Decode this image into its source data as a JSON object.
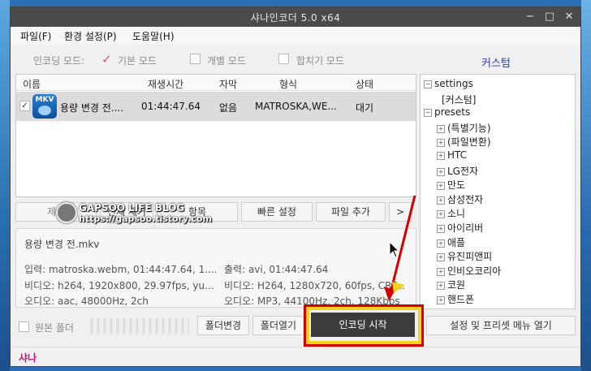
{
  "window": {
    "title": "샤나인코더  5.0 x64",
    "controls": {
      "minimize": "−",
      "maximize": "□",
      "close": "✕"
    }
  },
  "menu": [
    "파일(F)",
    "환경 설정(P)",
    "도움말(H)"
  ],
  "modes": {
    "label": "인코딩 모드:",
    "basic": "기본 모드",
    "individual": "개별 모드",
    "merge": "합치기 모드",
    "custom": "커스텀"
  },
  "list": {
    "headers": [
      "이름",
      "재생시간",
      "자막",
      "형식",
      "상태"
    ],
    "rows": [
      {
        "icon_badge": "MKV",
        "name": "용량 변경 전....",
        "duration": "01:44:47.64",
        "subtitle": "없음",
        "format": "MATROSKA,WE...",
        "status": "대기"
      }
    ]
  },
  "list_buttons": {
    "remove": "제거",
    "remove_all": "전체 제거",
    "item": "항목",
    "quick_settings": "빠른 설정",
    "add_file": "파일 추가",
    "more": ">"
  },
  "info": {
    "filename": "용량 변경 전.mkv",
    "input": "입력: matroska.webm, 01:44:47.64, 1....",
    "output": "출력: avi, 01:44:47.64",
    "video_in": "비디오: h264, 1920x800, 29.97fps,  yu...",
    "video_out": "비디오: H264, 1280x720, 60fps, CRF...",
    "audio_in": "오디오: aac, 48000Hz, 2ch",
    "audio_out": "오디오: MP3, 44100Hz, 2ch, 128Kbps"
  },
  "tree": [
    {
      "label": "settings",
      "level": 0,
      "expander": "−"
    },
    {
      "label": "[커스텀]",
      "level": 1,
      "expander": ""
    },
    {
      "label": "presets",
      "level": 0,
      "expander": "−"
    },
    {
      "label": "(특별기능)",
      "level": 1,
      "expander": "+"
    },
    {
      "label": "(파일변환)",
      "level": 1,
      "expander": "+"
    },
    {
      "label": "HTC",
      "level": 1,
      "expander": "+"
    },
    {
      "label": "LG전자",
      "level": 1,
      "expander": "+"
    },
    {
      "label": "만도",
      "level": 1,
      "expander": "+"
    },
    {
      "label": "삼성전자",
      "level": 1,
      "expander": "+"
    },
    {
      "label": "소니",
      "level": 1,
      "expander": "+"
    },
    {
      "label": "아이리버",
      "level": 1,
      "expander": "+"
    },
    {
      "label": "애플",
      "level": 1,
      "expander": "+"
    },
    {
      "label": "유진피앤피",
      "level": 1,
      "expander": "+"
    },
    {
      "label": "인비오코리아",
      "level": 1,
      "expander": "+"
    },
    {
      "label": "코원",
      "level": 1,
      "expander": "+"
    },
    {
      "label": "핸드폰",
      "level": 1,
      "expander": "+"
    }
  ],
  "bottom": {
    "source_folder": "원본 폴더",
    "change_folder": "폴더변경",
    "open_folder": "폴더열기",
    "start_encoding": "인코딩 시작",
    "settings_menu": "설정 및 프리셋 메뉴 열기"
  },
  "status_text": "샤나",
  "watermark": {
    "line1": "GAPSOO LIFE BLOG",
    "line2": "https://gapsoo.tistory.com"
  },
  "colors": {
    "accent": "#2e3f9e",
    "status_text": "#c0187a",
    "highlight_red": "#d20000",
    "highlight_yellow": "#f2d21c"
  }
}
